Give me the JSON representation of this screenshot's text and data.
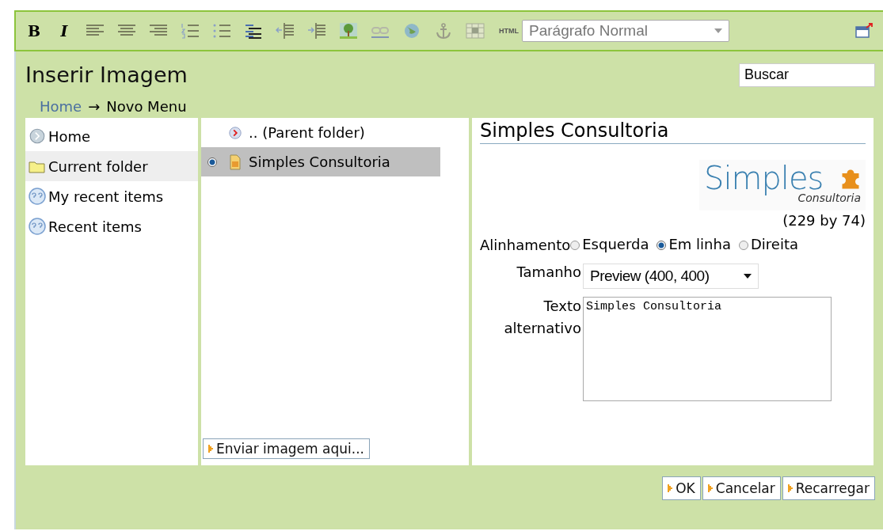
{
  "toolbar": {
    "format_buttons": [
      {
        "label": "B",
        "kind": "bold"
      },
      {
        "label": "I",
        "kind": "italic"
      }
    ],
    "html_button": "HTML",
    "style_select": {
      "value": "Parágrafo Normal"
    }
  },
  "dialog": {
    "title": "Inserir Imagem",
    "search": {
      "value": "Buscar"
    },
    "breadcrumb": {
      "items": [
        {
          "label": "Home",
          "kind": "link"
        },
        {
          "label": "Novo Menu",
          "kind": "current"
        }
      ],
      "separator": "→"
    },
    "sources": [
      {
        "label": "Home",
        "kind": "home",
        "selected": false
      },
      {
        "label": "Current folder",
        "kind": "folder",
        "selected": true
      },
      {
        "label": "My recent items",
        "kind": "recent",
        "selected": false
      },
      {
        "label": "Recent items",
        "kind": "recent",
        "selected": false
      }
    ],
    "files": [
      {
        "label": ".. (Parent folder)",
        "kind": "parent",
        "selected": false
      },
      {
        "label": "Simples Consultoria",
        "kind": "image",
        "selected": true
      }
    ],
    "upload_button": "Enviar imagem aqui...",
    "details": {
      "title": "Simples Consultoria",
      "preview": {
        "logo_text": "Simples",
        "logo_subtext": "Consultoria"
      },
      "dimensions": "(229 by 74)",
      "alignment_label": "Alinhamento",
      "alignment_options": [
        {
          "label": "Esquerda",
          "selected": false
        },
        {
          "label": "Em linha",
          "selected": true
        },
        {
          "label": "Direita",
          "selected": false
        }
      ],
      "size_label": "Tamanho",
      "size_value": "Preview (400, 400)",
      "alt_label": "Texto alternativo",
      "alt_value": "Simples Consultoria"
    },
    "buttons": [
      "OK",
      "Cancelar",
      "Recarregar"
    ]
  }
}
